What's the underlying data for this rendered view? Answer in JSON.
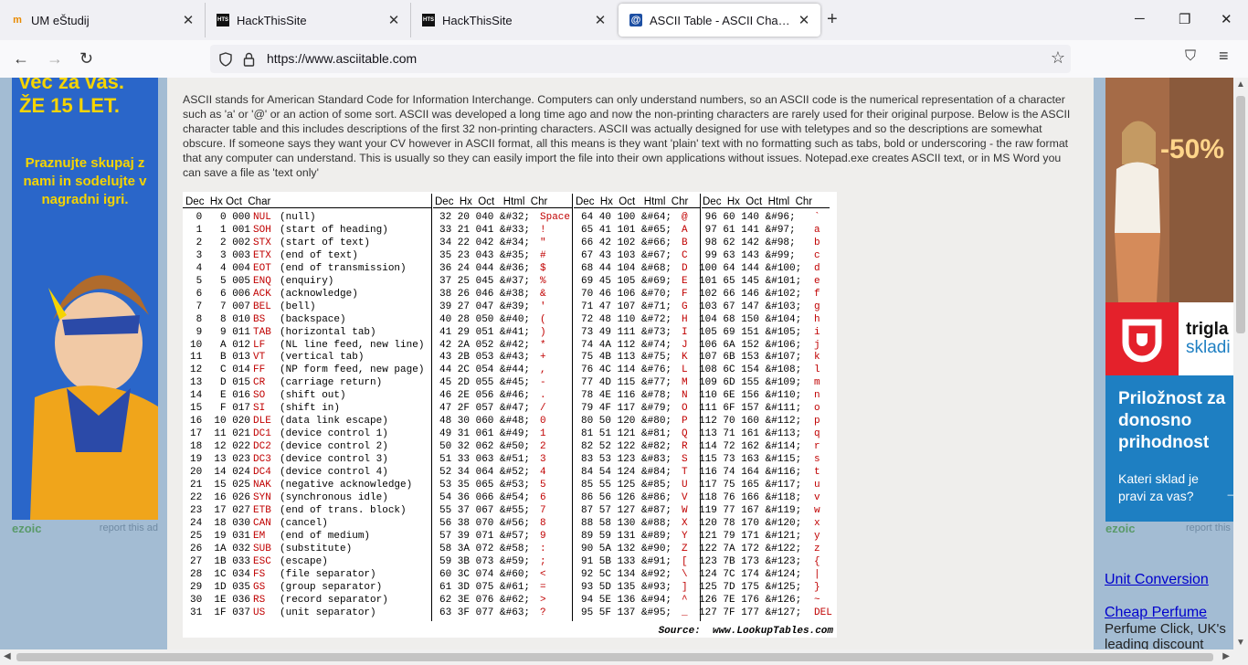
{
  "tabs": [
    {
      "title": "UM eŠtudij",
      "icon": "um-logo-icon"
    },
    {
      "title": "HackThisSite",
      "icon": "hts-logo-icon"
    },
    {
      "title": "HackThisSite",
      "icon": "hts-logo-icon"
    },
    {
      "title": "ASCII Table - ASCII Character Codes",
      "icon": "asciitable-logo-icon",
      "active": true
    }
  ],
  "url": "https://www.asciitable.com",
  "intro_text": "ASCII stands for American Standard Code for Information Interchange. Computers can only understand numbers, so an ASCII code is the numerical representation of a character such as 'a' or '@' or an action of some sort. ASCII was developed a long time ago and now the non-printing characters are rarely used for their original purpose. Below is the ASCII character table and this includes descriptions of the first 32 non-printing characters. ASCII was actually designed for use with teletypes and so the descriptions are somewhat obscure. If someone says they want your CV however in ASCII format, all this means is they want 'plain' text with no formatting such as tabs, bold or underscoring - the raw format that any computer can understand. This is usually so they can easily import the file into their own applications without issues. Notepad.exe creates ASCII text, or in MS Word you can save a file as 'text only'",
  "ascii_table": {
    "headers": {
      "g1": "Dec  Hx Oct  Char",
      "g2": "Dec  Hx  Oct   Html  Chr",
      "g3": "Dec  Hx  Oct   Html  Chr",
      "g4": "Dec  Hx  Oct  Html  Chr"
    },
    "g1_codes": " 0   0 000\n 1   1 001\n 2   2 002\n 3   3 003\n 4   4 004\n 5   5 005\n 6   6 006\n 7   7 007\n 8   8 010\n 9   9 011\n10   A 012\n11   B 013\n12   C 014\n13   D 015\n14   E 016\n15   F 017\n16  10 020\n17  11 021\n18  12 022\n19  13 023\n20  14 024\n21  15 025\n22  16 026\n23  17 027\n24  18 030\n25  19 031\n26  1A 032\n27  1B 033\n28  1C 034\n29  1D 035\n30  1E 036\n31  1F 037",
    "g1_names": "NUL\nSOH\nSTX\nETX\nEOT\nENQ\nACK\nBEL\nBS\nTAB\nLF\nVT\nFF\nCR\nSO\nSI\nDLE\nDC1\nDC2\nDC3\nDC4\nNAK\nSYN\nETB\nCAN\nEM\nSUB\nESC\nFS\nGS\nRS\nUS",
    "g1_desc": "(null)\n(start of heading)\n(start of text)\n(end of text)\n(end of transmission)\n(enquiry)\n(acknowledge)\n(bell)\n(backspace)\n(horizontal tab)\n(NL line feed, new line)\n(vertical tab)\n(NP form feed, new page)\n(carriage return)\n(shift out)\n(shift in)\n(data link escape)\n(device control 1)\n(device control 2)\n(device control 3)\n(device control 4)\n(negative acknowledge)\n(synchronous idle)\n(end of trans. block)\n(cancel)\n(end of medium)\n(substitute)\n(escape)\n(file separator)\n(group separator)\n(record separator)\n(unit separator)",
    "g2_codes": "32 20 040 &#32;\n33 21 041 &#33;\n34 22 042 &#34;\n35 23 043 &#35;\n36 24 044 &#36;\n37 25 045 &#37;\n38 26 046 &#38;\n39 27 047 &#39;\n40 28 050 &#40;\n41 29 051 &#41;\n42 2A 052 &#42;\n43 2B 053 &#43;\n44 2C 054 &#44;\n45 2D 055 &#45;\n46 2E 056 &#46;\n47 2F 057 &#47;\n48 30 060 &#48;\n49 31 061 &#49;\n50 32 062 &#50;\n51 33 063 &#51;\n52 34 064 &#52;\n53 35 065 &#53;\n54 36 066 &#54;\n55 37 067 &#55;\n56 38 070 &#56;\n57 39 071 &#57;\n58 3A 072 &#58;\n59 3B 073 &#59;\n60 3C 074 &#60;\n61 3D 075 &#61;\n62 3E 076 &#62;\n63 3F 077 &#63;",
    "g2_chars": "Space\n!\n\"\n#\n$\n%\n&\n'\n(\n)\n*\n+\n,\n-\n.\n/\n0\n1\n2\n3\n4\n5\n6\n7\n8\n9\n:\n;\n<\n=\n>\n?",
    "g3_codes": "64 40 100 &#64;\n65 41 101 &#65;\n66 42 102 &#66;\n67 43 103 &#67;\n68 44 104 &#68;\n69 45 105 &#69;\n70 46 106 &#70;\n71 47 107 &#71;\n72 48 110 &#72;\n73 49 111 &#73;\n74 4A 112 &#74;\n75 4B 113 &#75;\n76 4C 114 &#76;\n77 4D 115 &#77;\n78 4E 116 &#78;\n79 4F 117 &#79;\n80 50 120 &#80;\n81 51 121 &#81;\n82 52 122 &#82;\n83 53 123 &#83;\n84 54 124 &#84;\n85 55 125 &#85;\n86 56 126 &#86;\n87 57 127 &#87;\n88 58 130 &#88;\n89 59 131 &#89;\n90 5A 132 &#90;\n91 5B 133 &#91;\n92 5C 134 &#92;\n93 5D 135 &#93;\n94 5E 136 &#94;\n95 5F 137 &#95;",
    "g3_chars": "@\nA\nB\nC\nD\nE\nF\nG\nH\nI\nJ\nK\nL\nM\nN\nO\nP\nQ\nR\nS\nT\nU\nV\nW\nX\nY\nZ\n[\n\\\n]\n^\n_",
    "g4_codes": " 96 60 140 &#96;\n 97 61 141 &#97;\n 98 62 142 &#98;\n 99 63 143 &#99;\n100 64 144 &#100;\n101 65 145 &#101;\n102 66 146 &#102;\n103 67 147 &#103;\n104 68 150 &#104;\n105 69 151 &#105;\n106 6A 152 &#106;\n107 6B 153 &#107;\n108 6C 154 &#108;\n109 6D 155 &#109;\n110 6E 156 &#110;\n111 6F 157 &#111;\n112 70 160 &#112;\n113 71 161 &#113;\n114 72 162 &#114;\n115 73 163 &#115;\n116 74 164 &#116;\n117 75 165 &#117;\n118 76 166 &#118;\n119 77 167 &#119;\n120 78 170 &#120;\n121 79 171 &#121;\n122 7A 172 &#122;\n123 7B 173 &#123;\n124 7C 174 &#124;\n125 7D 175 &#125;\n126 7E 176 &#126;\n127 7F 177 &#127;",
    "g4_chars": "`\na\nb\nc\nd\ne\nf\ng\nh\ni\nj\nk\nl\nm\nn\no\np\nq\nr\ns\nt\nu\nv\nw\nx\ny\nz\n{\n|\n}\n~\nDEL",
    "source": "Source:  www.LookupTables.com"
  },
  "left_ad": {
    "top_line1": "več za vas.",
    "top_line2": "ŽE 15 LET.",
    "body": "Praznujte skupaj z nami in sodelujte v nagradni igri."
  },
  "right_ad": {
    "discount": "-50%",
    "brand_line1": "trigla",
    "brand_line2": "skladi",
    "headline": "Priložnost za donosno prihodnost",
    "question": "Kateri sklad je pravi za vas?"
  },
  "ezoic": {
    "brand": "ezoic",
    "report": "report this ad"
  },
  "right_links": [
    {
      "label": "Unit Conversion"
    },
    {
      "label": "Cheap Perfume",
      "sub": "Perfume Click, UK's leading discount"
    }
  ],
  "colors": {
    "page_bg": "#a3bcd3",
    "content_bg": "#efeeec",
    "red": "#c00000",
    "ad_blue": "#2a66c9",
    "triglav_red": "#e4212b",
    "triglav_blue": "#1e7fc2"
  }
}
